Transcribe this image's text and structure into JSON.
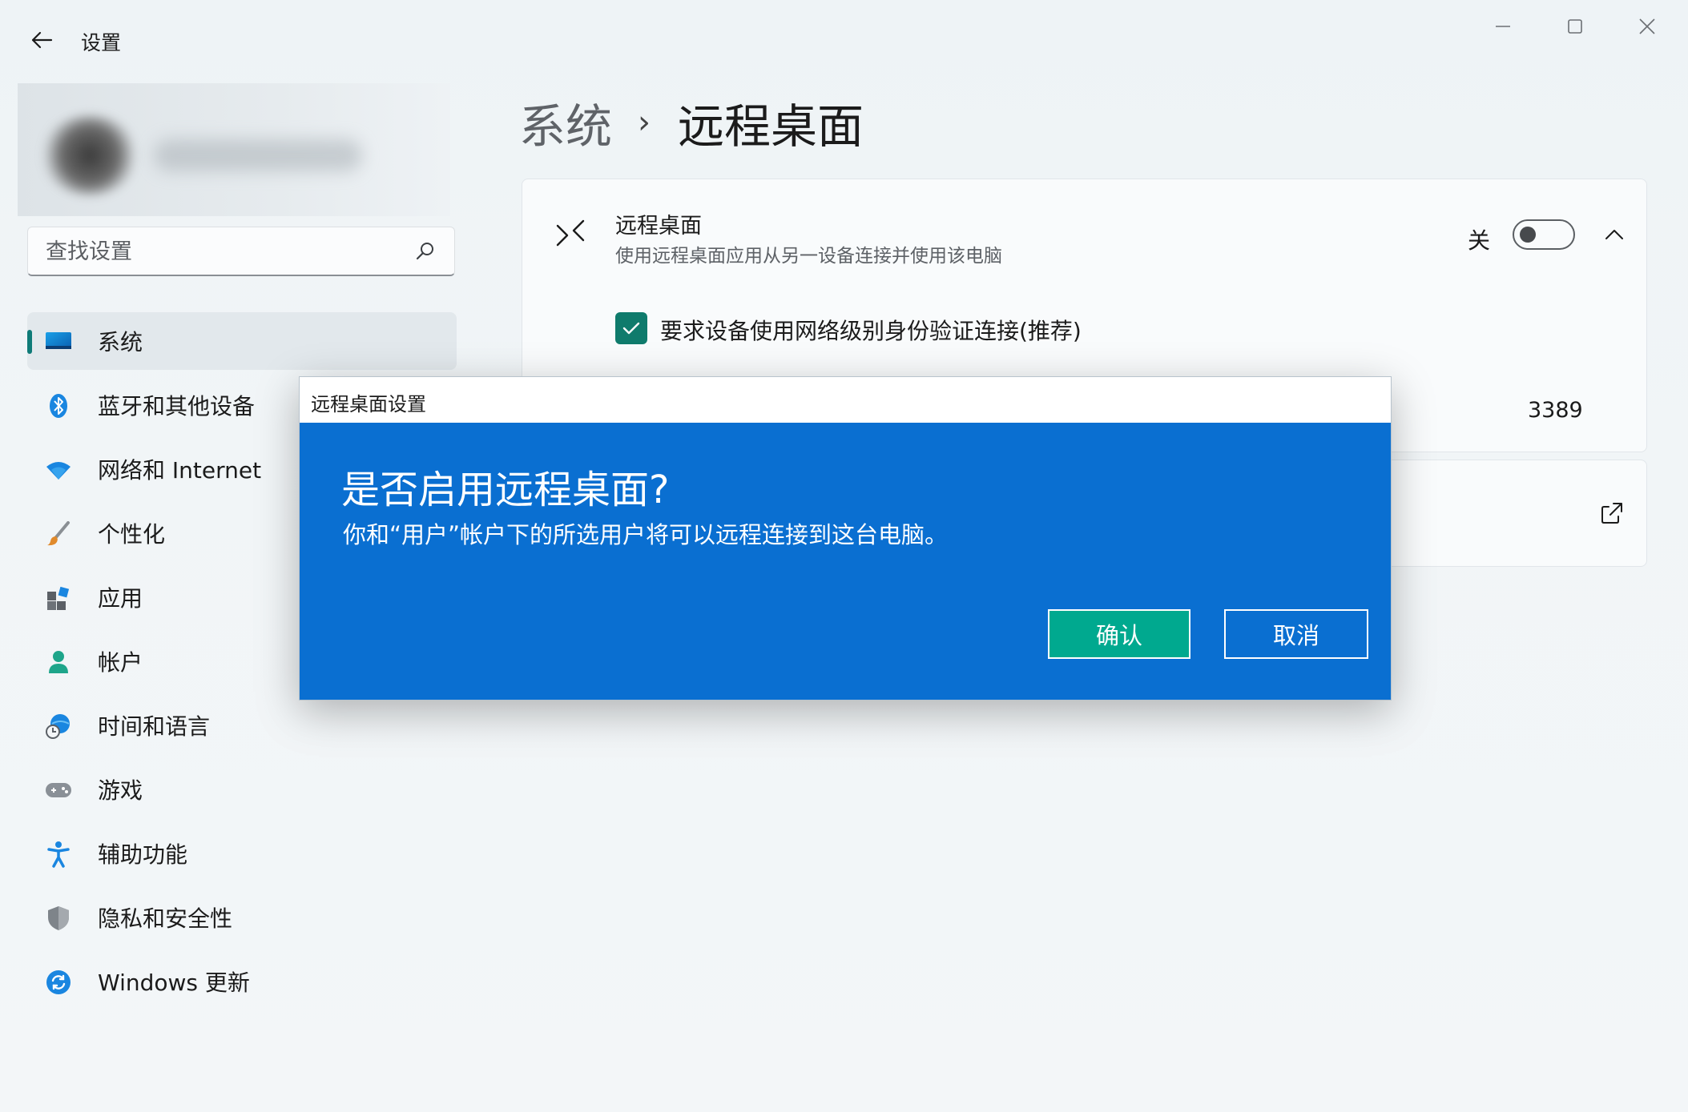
{
  "window": {
    "app_title": "设置",
    "controls": [
      "minimize",
      "maximize",
      "close"
    ]
  },
  "search": {
    "placeholder": "查找设置"
  },
  "sidebar": {
    "items": [
      {
        "label": "系统",
        "icon": "monitor-icon",
        "selected": true
      },
      {
        "label": "蓝牙和其他设备",
        "icon": "bluetooth-icon"
      },
      {
        "label": "网络和 Internet",
        "icon": "wifi-icon"
      },
      {
        "label": "个性化",
        "icon": "paintbrush-icon"
      },
      {
        "label": "应用",
        "icon": "apps-icon"
      },
      {
        "label": "帐户",
        "icon": "person-icon"
      },
      {
        "label": "时间和语言",
        "icon": "globe-clock-icon"
      },
      {
        "label": "游戏",
        "icon": "gamepad-icon"
      },
      {
        "label": "辅助功能",
        "icon": "accessibility-icon"
      },
      {
        "label": "隐私和安全性",
        "icon": "shield-icon"
      },
      {
        "label": "Windows 更新",
        "icon": "update-icon"
      }
    ]
  },
  "breadcrumb": {
    "parent": "系统",
    "separator": "›",
    "current": "远程桌面"
  },
  "remote_desktop": {
    "title": "远程桌面",
    "description": "使用远程桌面应用从另一设备连接并使用该电脑",
    "toggle_state": "关",
    "toggle_on": false,
    "nla_label": "要求设备使用网络级别身份验证连接(推荐)",
    "nla_checked": true,
    "port_value": "3389"
  },
  "dialog": {
    "title": "远程桌面设置",
    "heading": "是否启用远程桌面?",
    "message": "你和“用户”帐户下的所选用户将可以远程连接到这台电脑。",
    "confirm_label": "确认",
    "cancel_label": "取消"
  },
  "colors": {
    "accent": "#0f7b78",
    "dialog_bg": "#0a6fd1",
    "confirm_bg": "#00a98f",
    "checkbox": "#0f7b6c"
  }
}
